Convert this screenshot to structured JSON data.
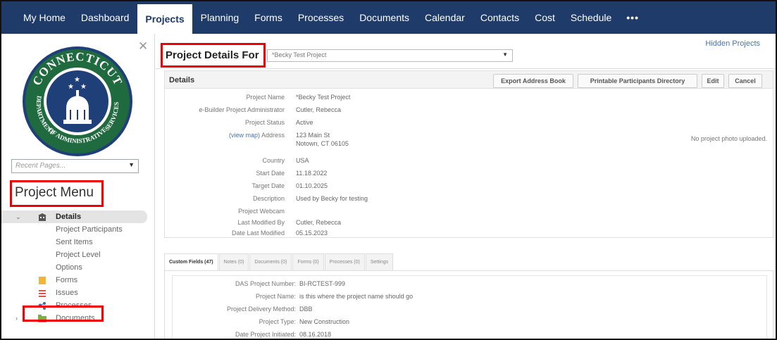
{
  "topnav": {
    "items": [
      "My Home",
      "Dashboard",
      "Projects",
      "Planning",
      "Forms",
      "Processes",
      "Documents",
      "Calendar",
      "Contacts",
      "Cost",
      "Schedule"
    ],
    "active": "Projects",
    "more_label": "•••",
    "bg_color": "#1e3b6a"
  },
  "sidebar": {
    "seal": {
      "top_text": "CONNECTICUT",
      "left_text": "DEPARTMENT",
      "right_text": "SERVICES",
      "bottom_text": "OF ADMINISTRATIVE"
    },
    "recent_pages_placeholder": "Recent Pages...",
    "menu_title": "Project Menu",
    "items": [
      {
        "label": "Details",
        "icon": "building-icon",
        "selected": true,
        "expanded": true
      },
      {
        "label": "Project Participants",
        "sub": true
      },
      {
        "label": "Sent Items",
        "sub": true
      },
      {
        "label": "Project Level",
        "sub": true
      },
      {
        "label": "Options",
        "sub": true
      },
      {
        "label": "Forms",
        "icon": "forms-icon"
      },
      {
        "label": "Issues",
        "icon": "issues-icon"
      },
      {
        "label": "Processes",
        "icon": "processes-icon"
      },
      {
        "label": "Documents",
        "icon": "folder-icon",
        "collapsed": true
      }
    ]
  },
  "main": {
    "hidden_projects_link": "Hidden Projects",
    "title": "Project Details For",
    "project_select_value": "*Becky Test Project",
    "details_label": "Details",
    "buttons": [
      "Export Address Book",
      "Printable Participants Directory",
      "Edit",
      "Cancel"
    ],
    "fields": [
      {
        "label": "Project Name",
        "value": "*Becky Test Project"
      },
      {
        "label": "e-Builder Project Administrator",
        "value": "Cutler, Rebecca"
      },
      {
        "label": "Project Status",
        "value": "Active"
      },
      {
        "label": "Address",
        "link": "(view map)",
        "value": "123 Main St",
        "value2": "Notown, CT 06105"
      },
      {
        "label": "Country",
        "value": "USA"
      },
      {
        "label": "Start Date",
        "value": "11.18.2022"
      },
      {
        "label": "Target Date",
        "value": "01.10.2025"
      },
      {
        "label": "Description",
        "value": "Used by Becky for testing"
      },
      {
        "label": "Project Webcam",
        "value": ""
      },
      {
        "label": "Last Modified By",
        "value": "Cutler, Rebecca"
      },
      {
        "label": "Date Last Modified",
        "value": "05.15.2023"
      }
    ],
    "no_photo": "No project photo uploaded.",
    "tabs": [
      "Custom Fields (47)",
      "Notes (0)",
      "Documents (0)",
      "Forms (0)",
      "Processes (0)",
      "Settings"
    ],
    "custom_fields": [
      {
        "label": "DAS Project Number:",
        "value": "BI-RCTEST-999"
      },
      {
        "label": "Project Name:",
        "value": "is this where the project name should go"
      },
      {
        "label": "Project Delivery Method:",
        "value": "DBB"
      },
      {
        "label": "Project Type:",
        "value": "New Construction"
      },
      {
        "label": "Date Project Initiated:",
        "value": "08.16.2018"
      }
    ]
  }
}
